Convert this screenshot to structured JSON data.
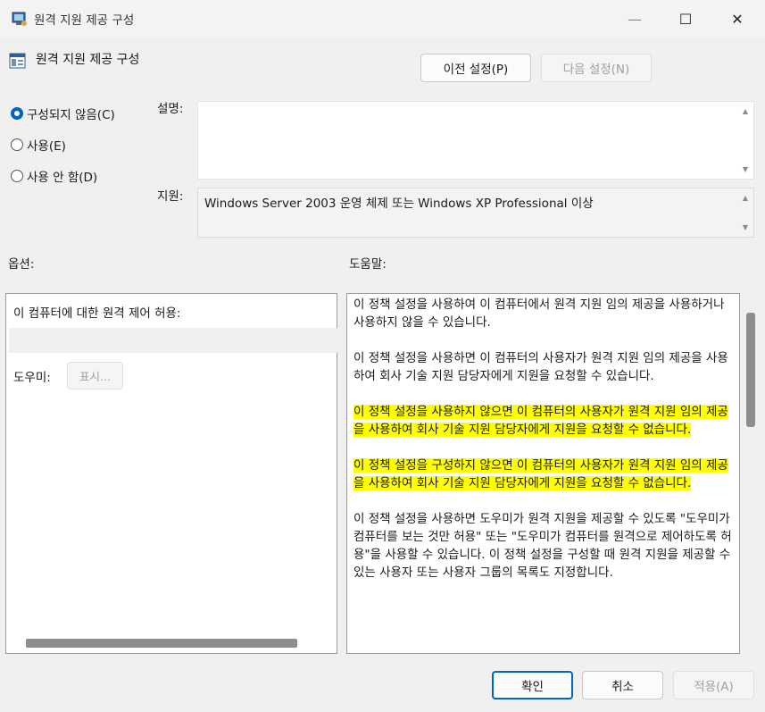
{
  "window": {
    "title": "원격 지원 제공 구성",
    "minimize_glyph": "—",
    "maximize_glyph": "☐",
    "close_glyph": "✕"
  },
  "header": {
    "title": "원격 지원 제공 구성",
    "prev_button": "이전 설정(P)",
    "next_button": "다음 설정(N)"
  },
  "state": {
    "options": [
      {
        "label": "구성되지 않음(C)",
        "selected": true
      },
      {
        "label": "사용(E)",
        "selected": false
      },
      {
        "label": "사용 안 함(D)",
        "selected": false
      }
    ]
  },
  "comment": {
    "label": "설명:",
    "value": ""
  },
  "supported": {
    "label": "지원:",
    "value": "Windows Server 2003 운영 체제 또는 Windows XP Professional 이상"
  },
  "options_section": {
    "label": "옵션:",
    "allow_label": "이 컴퓨터에 대한 원격 제어 허용:",
    "helpers_label": "도우미:",
    "show_button": "표시..."
  },
  "help_section": {
    "label": "도움말:",
    "paragraphs": [
      "이 정책 설정을 사용하여 이 컴퓨터에서 원격 지원 임의 제공을 사용하거나 사용하지 않을 수 있습니다.",
      "이 정책 설정을 사용하면 이 컴퓨터의 사용자가 원격 지원 임의 제공을 사용하여 회사 기술 지원 담당자에게 지원을 요청할 수 있습니다.",
      "이 정책 설정을 사용하지 않으면 이 컴퓨터의 사용자가 원격 지원 임의 제공을 사용하여 회사 기술 지원 담당자에게 지원을 요청할 수 없습니다.",
      "이 정책 설정을 구성하지 않으면 이 컴퓨터의 사용자가 원격 지원 임의 제공을 사용하여 회사 기술 지원 담당자에게 지원을 요청할 수 없습니다.",
      "이 정책 설정을 사용하면 도우미가 원격 지원을 제공할 수 있도록 \"도우미가 컴퓨터를 보는 것만 허용\" 또는 \"도우미가 컴퓨터를 원격으로 제어하도록 허용\"을 사용할 수 있습니다. 이 정책 설정을 구성할 때 원격 지원을 제공할 수 있는 사용자 또는 사용자 그룹의 목록도 지정합니다."
    ]
  },
  "footer": {
    "ok": "확인",
    "cancel": "취소",
    "apply": "적용(A)"
  },
  "colors": {
    "accent": "#0067c0",
    "highlight": "#ffff00"
  }
}
